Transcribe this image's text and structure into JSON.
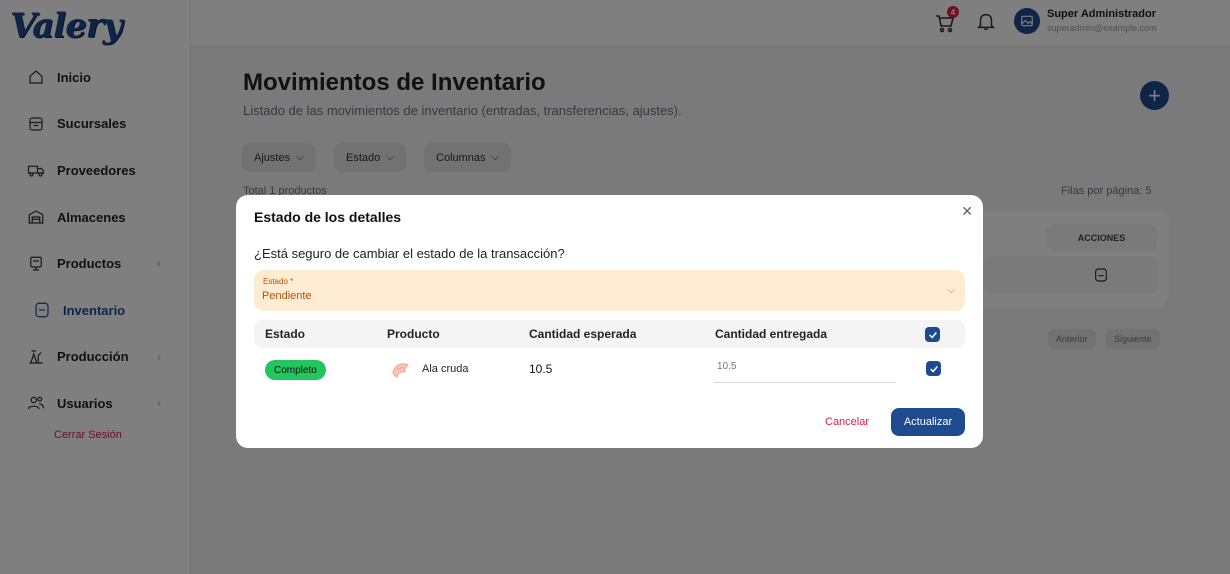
{
  "brand": {
    "logo_text": "Valery"
  },
  "sidebar": {
    "items": [
      {
        "label": "Inicio",
        "icon": "home-icon"
      },
      {
        "label": "Sucursales",
        "icon": "store-icon"
      },
      {
        "label": "Proveedores",
        "icon": "truck-icon"
      },
      {
        "label": "Almacenes",
        "icon": "warehouse-icon"
      },
      {
        "label": "Productos",
        "icon": "product-icon",
        "has_submenu": true
      },
      {
        "label": "Inventario",
        "icon": "inventory-icon",
        "active": true
      },
      {
        "label": "Producción",
        "icon": "production-icon",
        "has_submenu": true
      },
      {
        "label": "Usuarios",
        "icon": "users-icon",
        "has_submenu": true
      }
    ],
    "logout": "Cerrar Sesión"
  },
  "header": {
    "cart_badge": "4",
    "user_name": "Super Administrador",
    "user_email": "superadmin@example.com"
  },
  "page": {
    "title": "Movimientos de Inventario",
    "subtitle": "Listado de las movimientos de inventario (entradas, transferencias, ajustes).",
    "filters": [
      "Ajustes",
      "Estado",
      "Columnas"
    ],
    "total": "Total 1 productos",
    "per_page": "Filas por página: 5",
    "table_header_actions": "ACCIONES",
    "pagination": {
      "prev": "Anterior",
      "next": "Siguiente"
    }
  },
  "modal": {
    "title": "Estado de los detalles",
    "question": "¿Está seguro de cambiar el estado de la transacción?",
    "select": {
      "label": "Estado *",
      "value": "Pendiente"
    },
    "columns": [
      "Estado",
      "Producto",
      "Cantidad esperada",
      "Cantidad entregada"
    ],
    "rows": [
      {
        "status": "Completo",
        "product": "Ala cruda",
        "expected": "10.5",
        "delivered_placeholder": "10.5",
        "checked": true
      }
    ],
    "cancel": "Cancelar",
    "update": "Actualizar"
  },
  "colors": {
    "brand": "#1e4a8f",
    "danger": "#e11d48",
    "success": "#22c55e",
    "warning_bg": "#fdebd2",
    "warning_text": "#b45309"
  }
}
